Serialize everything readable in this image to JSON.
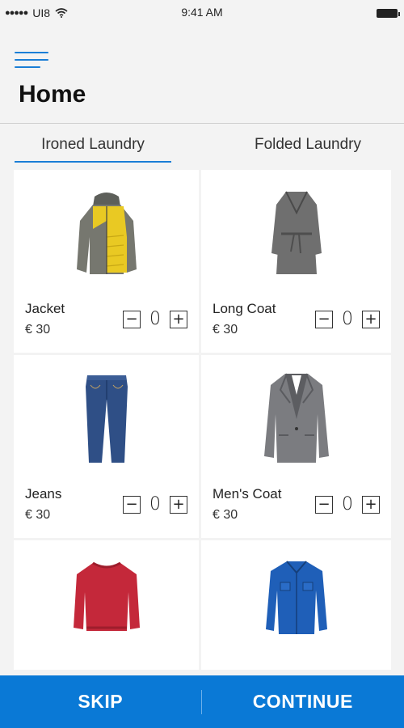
{
  "status_bar": {
    "carrier": "UI8",
    "time": "9:41 AM"
  },
  "header": {
    "title": "Home"
  },
  "tabs": [
    {
      "label": "Ironed Laundry",
      "active": true
    },
    {
      "label": "Folded Laundry",
      "active": false
    }
  ],
  "products": [
    {
      "name": "Jacket",
      "price": "€ 30",
      "qty": "0",
      "image": "puffer-jacket-icon"
    },
    {
      "name": "Long Coat",
      "price": "€ 30",
      "qty": "0",
      "image": "long-coat-icon"
    },
    {
      "name": "Jeans",
      "price": "€ 30",
      "qty": "0",
      "image": "jeans-icon"
    },
    {
      "name": "Men's Coat",
      "price": "€ 30",
      "qty": "0",
      "image": "blazer-icon"
    },
    {
      "image": "sweater-icon"
    },
    {
      "image": "shirt-icon"
    }
  ],
  "controls": {
    "minus": "−",
    "plus": "+"
  },
  "footer": {
    "skip_label": "SKIP",
    "continue_label": "CONTINUE"
  },
  "colors": {
    "accent": "#0a79d6",
    "background": "#f3f3f3"
  }
}
